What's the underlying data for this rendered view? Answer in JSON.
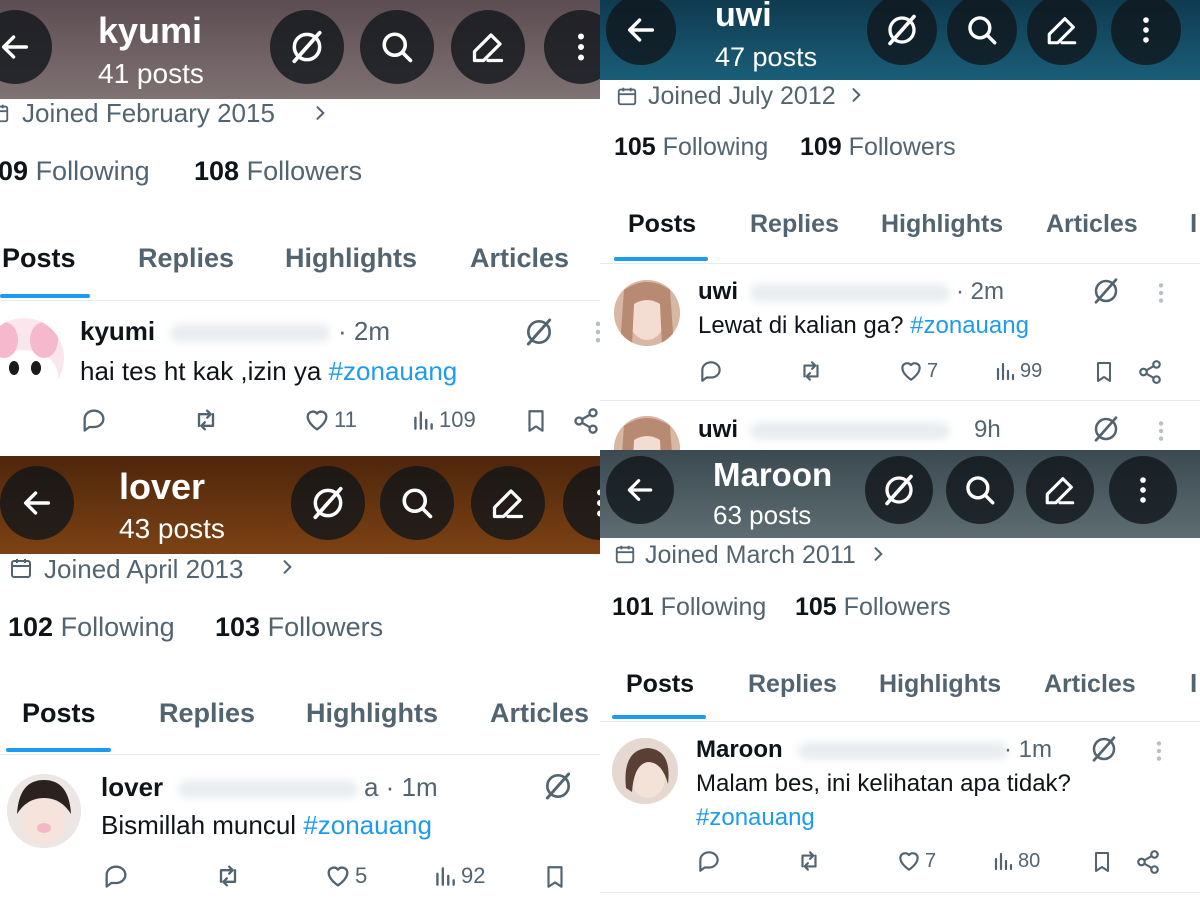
{
  "panels": {
    "tl": {
      "name": "kyumi",
      "posts": "41 posts",
      "joined": "Joined February 2015",
      "following_count": "09",
      "following_label": "Following",
      "followers_count": "108",
      "followers_label": "Followers",
      "tabs": [
        "Posts",
        "Replies",
        "Highlights",
        "Articles"
      ],
      "post": {
        "author": "kyumi",
        "time": "· 2m",
        "text": "hai tes ht kak ,izin ya ",
        "hashtag": "#zonauang",
        "likes": "11",
        "views": "109"
      },
      "header_color": "#6f6466"
    },
    "tr": {
      "name": "uwi",
      "posts": "47 posts",
      "joined": "Joined July 2012",
      "following_count": "105",
      "following_label": "Following",
      "followers_count": "109",
      "followers_label": "Followers",
      "tabs": [
        "Posts",
        "Replies",
        "Highlights",
        "Articles"
      ],
      "post": {
        "author": "uwi",
        "time": "· 2m",
        "text": "Lewat di kalian ga? ",
        "hashtag": "#zonauang",
        "likes": "7",
        "views": "99"
      },
      "post2": {
        "author": "uwi",
        "time": "9h"
      },
      "header_color": "#17546e"
    },
    "bl": {
      "name": "lover",
      "posts": "43 posts",
      "joined": "Joined April 2013",
      "following_count": "102",
      "following_label": "Following",
      "followers_count": "103",
      "followers_label": "Followers",
      "tabs": [
        "Posts",
        "Replies",
        "Highlights",
        "Articles"
      ],
      "post": {
        "author": "lover",
        "time": "a · 1m",
        "text": "Bismillah muncul ",
        "hashtag": "#zonauang",
        "likes": "5",
        "views": "92"
      },
      "header_color": "#6b3712"
    },
    "br": {
      "name": "Maroon",
      "posts": "63 posts",
      "joined": "Joined March 2011",
      "following_count": "101",
      "following_label": "Following",
      "followers_count": "105",
      "followers_label": "Followers",
      "tabs": [
        "Posts",
        "Replies",
        "Highlights",
        "Articles"
      ],
      "post": {
        "author": "Maroon",
        "time": "· 1m",
        "text": "Malam bes, ini kelihatan apa tidak?",
        "hashtag": "#zonauang",
        "likes": "7",
        "views": "80"
      },
      "header_color": "#4a5a60"
    }
  },
  "colors": {
    "accent": "#1d9bf0",
    "text": "#0f1419",
    "muted": "#536471"
  },
  "icons": [
    "back-arrow-icon",
    "grok-icon",
    "search-icon",
    "edit-icon",
    "more-vert-icon",
    "calendar-icon",
    "chevron-right-icon",
    "reply-icon",
    "repost-icon",
    "like-icon",
    "views-icon",
    "bookmark-icon",
    "share-icon"
  ]
}
